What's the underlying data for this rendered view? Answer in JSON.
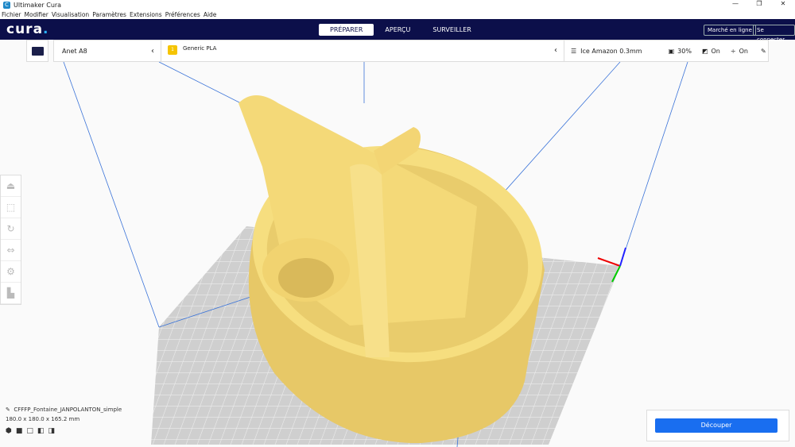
{
  "window": {
    "title": "Ultimaker Cura",
    "controls": [
      "—",
      "❐",
      "✕"
    ]
  },
  "menu": [
    "Fichier",
    "Modifier",
    "Visualisation",
    "Paramètres",
    "Extensions",
    "Préférences",
    "Aide"
  ],
  "header": {
    "logo": "cura",
    "tabs": [
      "PRÉPARER",
      "APERÇU",
      "SURVEILLER"
    ],
    "active_tab": 0,
    "marketplace": "Marché en ligne",
    "signin": "Se connecter"
  },
  "printer": {
    "name": "Anet A8"
  },
  "material": {
    "name": "Generic PLA",
    "badge": "1"
  },
  "settings": {
    "profile": "Ice Amazon 0.3mm",
    "infill": "30%",
    "support": "On",
    "adhesion": "On"
  },
  "object": {
    "name": "CFFFP_Fontaine_JANPOLANTON_simple",
    "dimensions": "180.0 x 180.0 x 165.2 mm"
  },
  "slice": {
    "label": "Découper"
  },
  "colors": {
    "header": "#0c0f4a",
    "accent": "#196ef0",
    "model": "#f5dc7a"
  }
}
